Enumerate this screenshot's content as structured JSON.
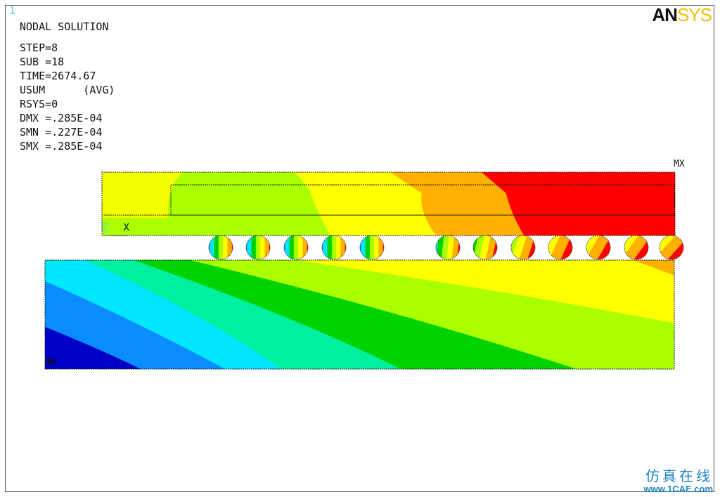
{
  "window": {
    "number": "1"
  },
  "result": {
    "title": "NODAL SOLUTION",
    "lines": [
      "STEP=8",
      "SUB =18",
      "TIME=2674.67",
      "USUM      (AVG)",
      "RSYS=0",
      "DMX =.285E-04",
      "SMN =.227E-04",
      "SMX =.285E-04"
    ]
  },
  "logo": {
    "part1": "AN",
    "part2": "SYS"
  },
  "markers": {
    "max": "MX",
    "min": "MN"
  },
  "triad": {
    "z": "Z",
    "x": "X"
  },
  "watermark": {
    "cn": "仿真在线",
    "url": "www.1CAE.com"
  },
  "colors": {
    "blue": "#0000c8",
    "mid_blue": "#0a8cff",
    "cyan": "#00e6ff",
    "teal": "#00f0a0",
    "green": "#00d200",
    "yellow_green": "#aaff00",
    "yellow": "#ffff00",
    "orange": "#ffb000",
    "red": "#ff0000"
  }
}
